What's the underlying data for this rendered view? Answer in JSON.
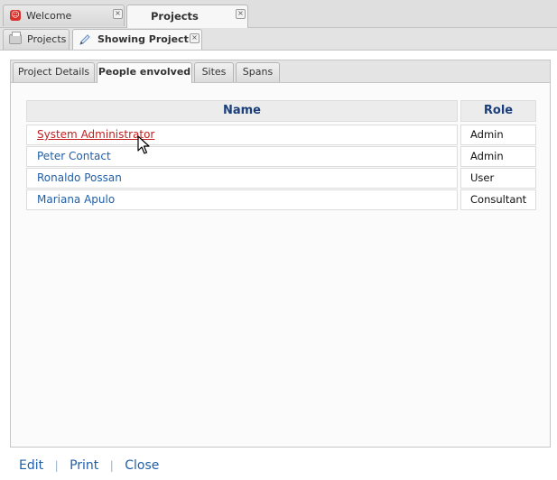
{
  "top_tabs": [
    {
      "label": "Welcome",
      "active": false
    },
    {
      "label": "Projects",
      "active": true
    }
  ],
  "sub_tabs": [
    {
      "label": "Projects",
      "active": false
    },
    {
      "label": "Showing Project A",
      "active": true
    }
  ],
  "panel_tabs": [
    {
      "label": "Project Details",
      "active": false
    },
    {
      "label": "People envolved",
      "active": true
    },
    {
      "label": "Sites",
      "active": false
    },
    {
      "label": "Spans",
      "active": false
    }
  ],
  "table": {
    "columns": [
      "Name",
      "Role"
    ],
    "rows": [
      {
        "name": "System Administrator",
        "role": "Admin"
      },
      {
        "name": "Peter Contact",
        "role": "Admin"
      },
      {
        "name": "Ronaldo Possan",
        "role": "User"
      },
      {
        "name": "Mariana Apulo",
        "role": "Consultant"
      }
    ]
  },
  "actions": {
    "edit": "Edit",
    "separator": "|",
    "print": "Print",
    "close": "Close"
  },
  "colors": {
    "link": "#1f5fa8",
    "link_hover": "#c02020",
    "header_text": "#1b3f7a",
    "welcome_icon": "#d9312b"
  }
}
